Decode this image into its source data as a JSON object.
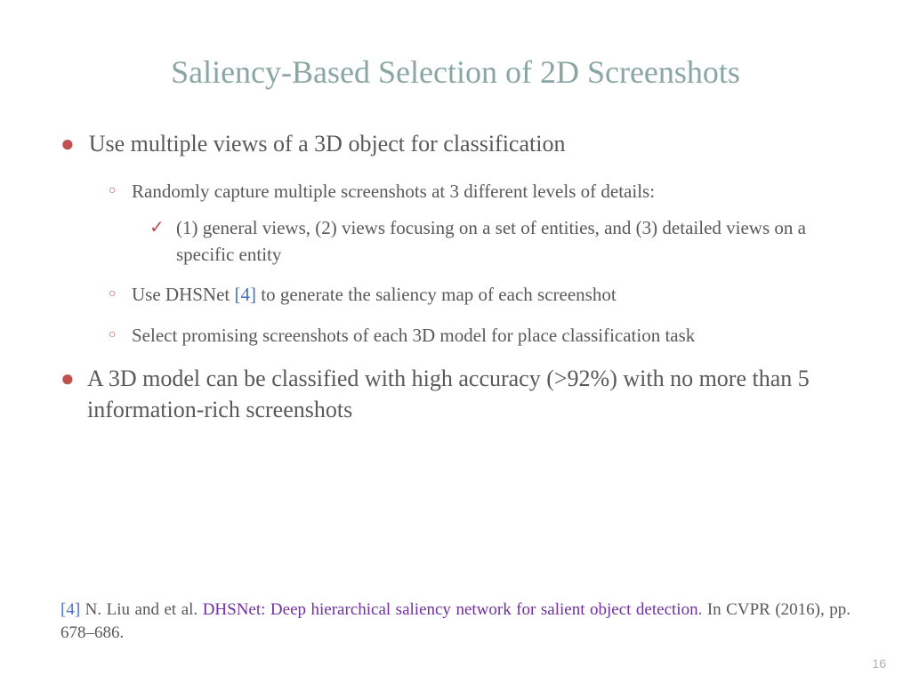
{
  "title": "Saliency-Based Selection of 2D Screenshots",
  "bullets": {
    "b1": "Use multiple views of a 3D object for classification",
    "b1_sub1": "Randomly capture multiple screenshots at 3 different levels of details:",
    "b1_sub1_detail": "(1) general views, (2) views focusing on a set of entities, and (3) detailed views on a specific entity",
    "b1_sub2_pre": "Use DHSNet ",
    "b1_sub2_ref": "[4]",
    "b1_sub2_post": " to generate the saliency map of each screenshot",
    "b1_sub3": "Select promising screenshots of each 3D model for place classification task",
    "b2": "A 3D model can be classified with high accuracy (>92%) with no more than 5 information-rich screenshots"
  },
  "citation": {
    "num": "[4]",
    "authors": " N. Liu and et al. ",
    "title": "DHSNet: Deep hierarchical saliency network for salient object detection",
    "venue": ". In CVPR (2016), pp. 678–686."
  },
  "page": "16"
}
